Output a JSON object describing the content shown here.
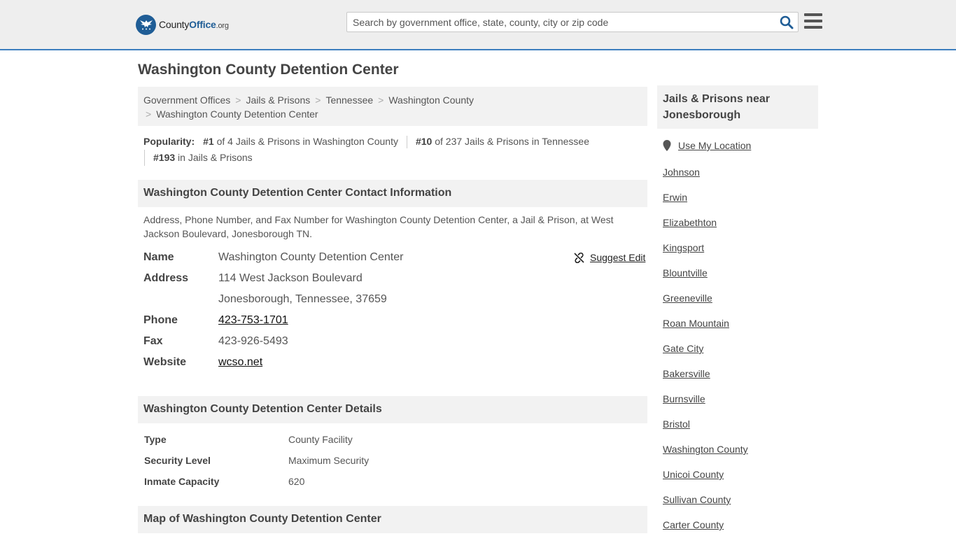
{
  "header": {
    "logo": {
      "brand_main": "County",
      "brand_accent": "Office",
      "brand_tld": ".org"
    },
    "search": {
      "placeholder": "Search by government office, state, county, city or zip code",
      "value": ""
    },
    "icons": {
      "search": "search-icon",
      "menu": "hamburger-menu-icon"
    },
    "colors": {
      "accent": "#1f5d96",
      "border": "#3d7fbf"
    }
  },
  "page": {
    "title": "Washington County Detention Center"
  },
  "breadcrumbs": [
    {
      "label": "Government Offices"
    },
    {
      "label": "Jails & Prisons"
    },
    {
      "label": "Tennessee"
    },
    {
      "label": "Washington County"
    },
    {
      "label": "Washington County Detention Center"
    }
  ],
  "popularity": {
    "label": "Popularity:",
    "items": [
      {
        "rank": "#1",
        "text": " of 4 Jails & Prisons in Washington County"
      },
      {
        "rank": "#10",
        "text": " of 237 Jails & Prisons in Tennessee"
      },
      {
        "rank": "#193",
        "text": " in Jails & Prisons"
      }
    ]
  },
  "contact": {
    "heading": "Washington County Detention Center Contact Information",
    "description": "Address, Phone Number, and Fax Number for Washington County Detention Center, a Jail & Prison, at West Jackson Boulevard, Jonesborough TN.",
    "suggest_edit": "Suggest Edit",
    "fields": {
      "name_label": "Name",
      "name": "Washington County Detention Center",
      "address_label": "Address",
      "address_line1": "114 West Jackson Boulevard",
      "address_line2": "Jonesborough, Tennessee, 37659",
      "phone_label": "Phone",
      "phone": "423-753-1701",
      "fax_label": "Fax",
      "fax": "423-926-5493",
      "website_label": "Website",
      "website": "wcso.net"
    }
  },
  "details": {
    "heading": "Washington County Detention Center Details",
    "rows": [
      {
        "label": "Type",
        "value": "County Facility"
      },
      {
        "label": "Security Level",
        "value": "Maximum Security"
      },
      {
        "label": "Inmate Capacity",
        "value": "620"
      }
    ]
  },
  "map": {
    "heading": "Map of Washington County Detention Center"
  },
  "sidebar": {
    "heading": "Jails & Prisons near Jonesborough",
    "use_location": "Use My Location",
    "links": [
      "Johnson",
      "Erwin",
      "Elizabethton",
      "Kingsport",
      "Blountville",
      "Greeneville",
      "Roan Mountain",
      "Gate City",
      "Bakersville",
      "Burnsville",
      "Bristol",
      "Washington County",
      "Unicoi County",
      "Sullivan County",
      "Carter County"
    ]
  }
}
